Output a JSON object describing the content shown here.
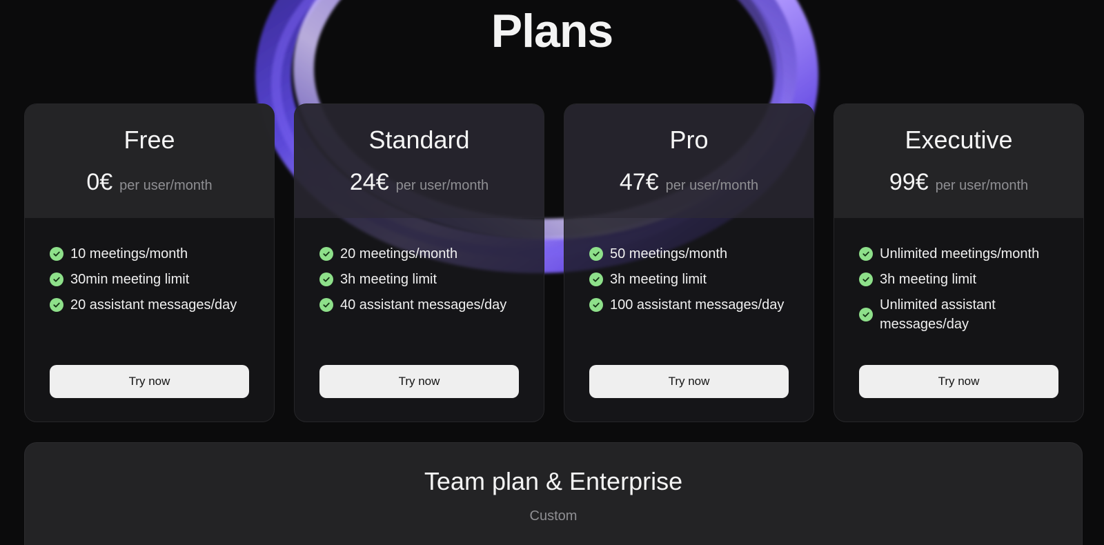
{
  "page": {
    "title": "Plans"
  },
  "plans": [
    {
      "name": "Free",
      "price": "0€",
      "unit": "per user/month",
      "features": [
        "10 meetings/month",
        "30min meeting limit",
        "20 assistant messages/day"
      ],
      "cta": "Try now"
    },
    {
      "name": "Standard",
      "price": "24€",
      "unit": "per user/month",
      "features": [
        "20 meetings/month",
        "3h meeting limit",
        "40 assistant messages/day"
      ],
      "cta": "Try now"
    },
    {
      "name": "Pro",
      "price": "47€",
      "unit": "per user/month",
      "features": [
        "50 meetings/month",
        "3h meeting limit",
        "100 assistant messages/day"
      ],
      "cta": "Try now"
    },
    {
      "name": "Executive",
      "price": "99€",
      "unit": "per user/month",
      "features": [
        "Unlimited meetings/month",
        "3h meeting limit",
        "Unlimited assistant messages/day"
      ],
      "cta": "Try now"
    }
  ],
  "team": {
    "title": "Team plan & Enterprise",
    "subtitle": "Custom"
  },
  "colors": {
    "background": "#0b0b0c",
    "card": "#161618",
    "card_header": "#262628",
    "check": "#8ee08a",
    "button": "#efefef",
    "ring_accent": "#8b6cf0"
  },
  "icons": {
    "feature_bullet": "check-circle-icon",
    "background_art": "purple-ring-graphic"
  }
}
